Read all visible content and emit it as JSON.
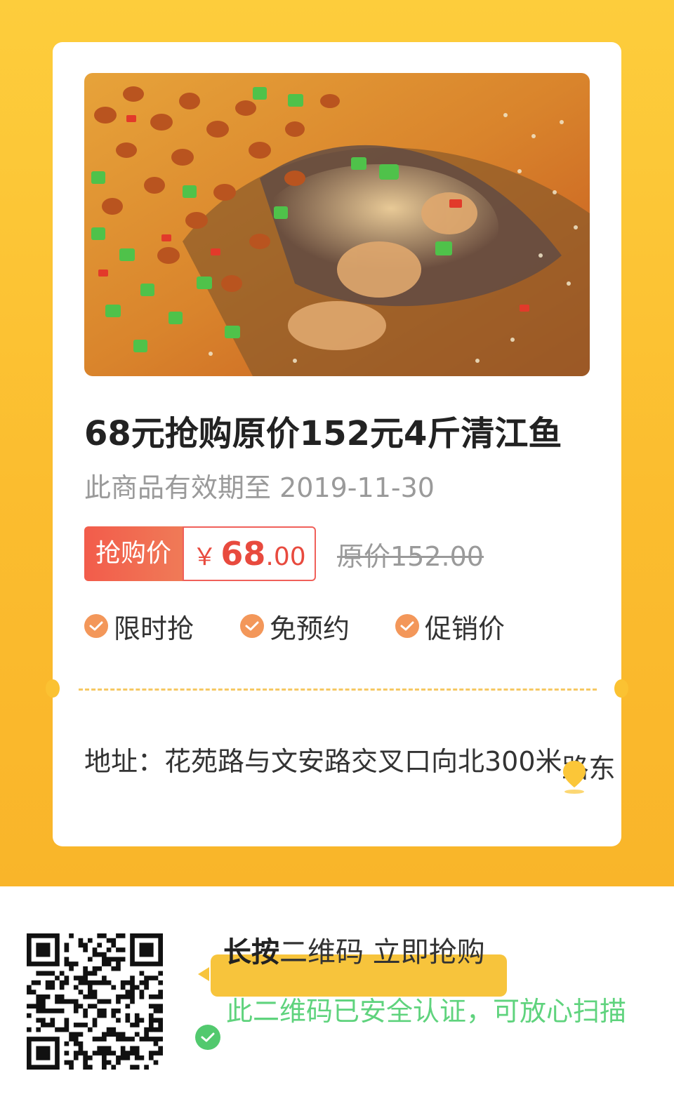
{
  "deal": {
    "title": "68元抢购原价152元4斤清江鱼",
    "validity_label": "此商品有效期至 ",
    "validity_date": "2019-11-30",
    "price_label": "抢购价",
    "currency_symbol": "￥",
    "price_integer": "68",
    "price_decimal": ".00",
    "original_price": "原价152.00"
  },
  "tags": [
    {
      "label": "限时抢",
      "icon": "check-circle-icon"
    },
    {
      "label": "免预约",
      "icon": "check-circle-icon"
    },
    {
      "label": "促销价",
      "icon": "check-circle-icon"
    }
  ],
  "address": {
    "text": "地址：花苑路与文安路交叉口向北300米",
    "tail": "路东"
  },
  "qr_section": {
    "cta_bold": "长按",
    "cta_text": "二维码 立即抢购",
    "secure_text": "此二维码已安全认证，可放心扫描"
  },
  "colors": {
    "background_yellow": "#fbbd2f",
    "price_red": "#e84a3e",
    "tag_orange": "#f3975a",
    "secure_green": "#52c96e"
  }
}
